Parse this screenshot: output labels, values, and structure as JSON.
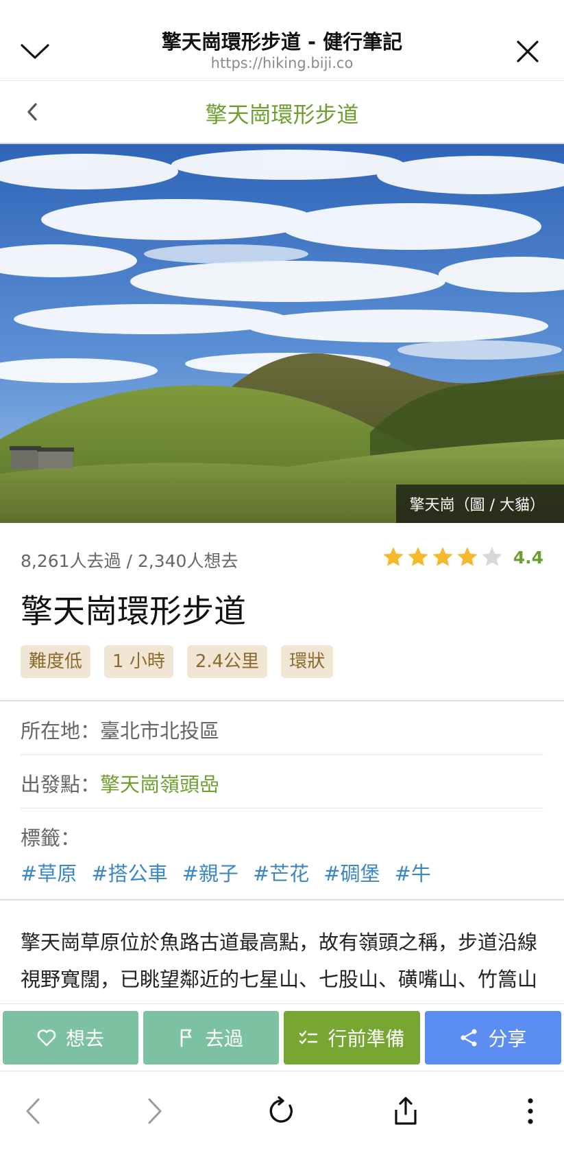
{
  "browser": {
    "title": "擎天崗環形步道 - 健行筆記",
    "url": "https://hiking.biji.co"
  },
  "header": {
    "title": "擎天崗環形步道"
  },
  "hero": {
    "caption": "擎天崗（圖 / 大貓）"
  },
  "info": {
    "stats": "8,261人去過 / 2,340人想去",
    "rating": {
      "value": 4.4,
      "label": "4.4",
      "stars_filled": 4,
      "stars_total": 5
    },
    "name": "擎天崗環形步道",
    "tags": [
      "難度低",
      "1 小時",
      "2.4公里",
      "環狀"
    ],
    "location_label": "所在地：",
    "location_value": "臺北市北投區",
    "start_label": "出發點：",
    "start_value": "擎天崗嶺頭喦",
    "labels_title": "標籤：",
    "hashtags": [
      "#草原",
      "#搭公車",
      "#親子",
      "#芒花",
      "#碉堡",
      "#牛"
    ]
  },
  "description": "擎天崗草原位於魚路古道最高點，故有嶺頭之稱，步道沿線視野寬闊，已眺望鄰近的七星山、七股山、磺嘴山、竹篙山等火山群，為主要特色，冬去即為園區",
  "actions": {
    "want": "想去",
    "been": "去過",
    "prep": "行前準備",
    "share": "分享"
  },
  "colors": {
    "accent_green": "#6e9e2f",
    "hashtag_blue": "#3b86c6",
    "tag_bg": "#f1e6d3",
    "tag_text": "#8b6a2e",
    "btn_teal": "#7cc2a2",
    "btn_green": "#77a632",
    "btn_blue": "#5b8ef0",
    "star_gold": "#f5b82e"
  }
}
